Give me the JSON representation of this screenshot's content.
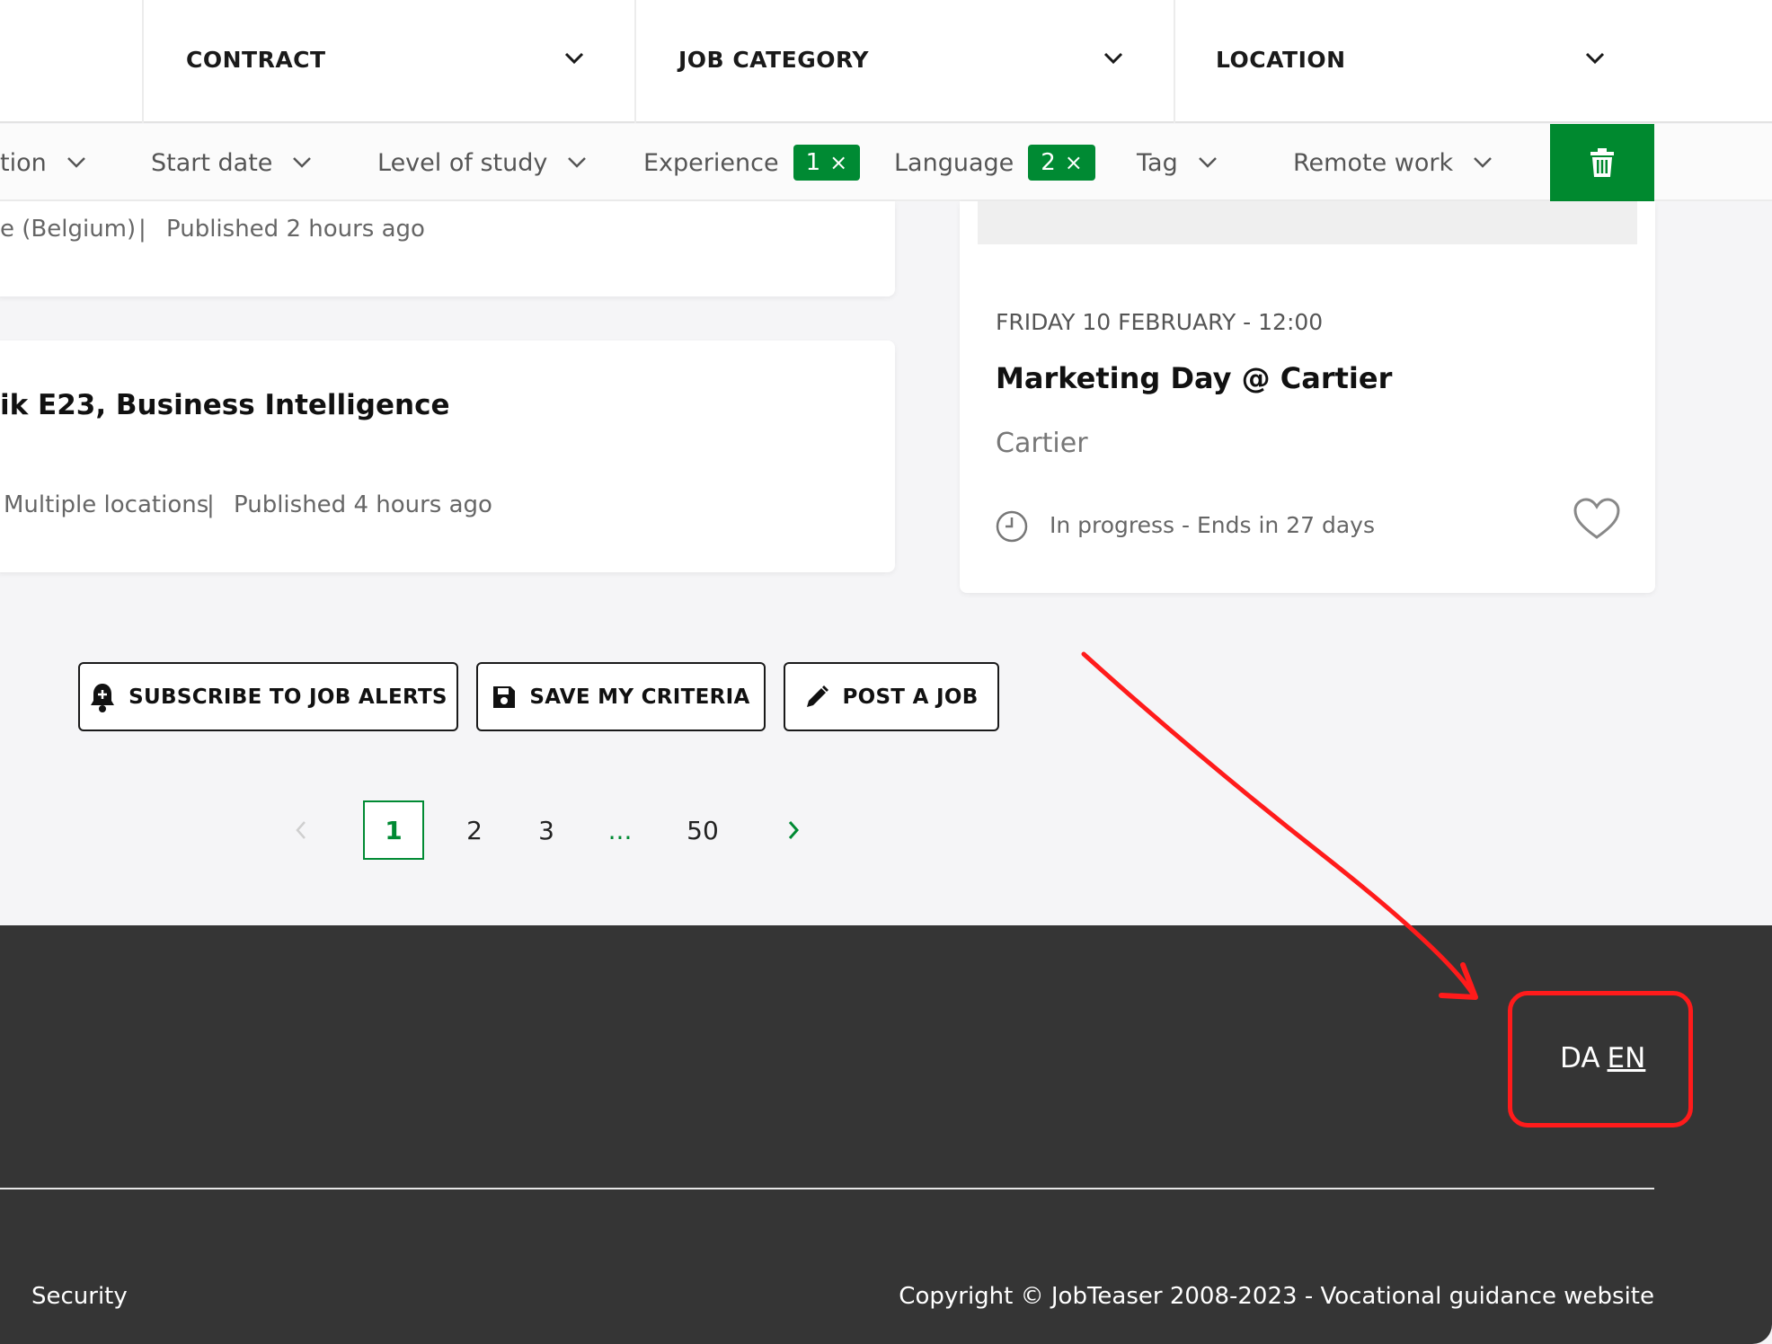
{
  "top_filters": [
    {
      "label": "CONTRACT"
    },
    {
      "label": "JOB CATEGORY"
    },
    {
      "label": "LOCATION"
    }
  ],
  "filters": [
    {
      "label": "tion",
      "badge": null
    },
    {
      "label": "Start date",
      "badge": null
    },
    {
      "label": "Level of study",
      "badge": null
    },
    {
      "label": "Experience",
      "badge": "1"
    },
    {
      "label": "Language",
      "badge": "2"
    },
    {
      "label": "Tag",
      "badge": null
    },
    {
      "label": "Remote work",
      "badge": null
    }
  ],
  "badge_close": "×",
  "job_card_1": {
    "location": "e (Belgium)",
    "sep": "|",
    "published": "Published 2 hours ago"
  },
  "job_card_2": {
    "title": "ik E23, Business Intelligence",
    "location": "Multiple locations",
    "sep": "|",
    "published": "Published 4 hours ago"
  },
  "event_card": {
    "date": "FRIDAY 10 FEBRUARY - 12:00",
    "title": "Marketing Day @ Cartier",
    "company": "Cartier",
    "status": "In progress - Ends in 27 days"
  },
  "actions": {
    "subscribe": "SUBSCRIBE TO JOB ALERTS",
    "save": "SAVE MY CRITERIA",
    "post": "POST A JOB"
  },
  "pagination": {
    "pages": [
      "1",
      "2",
      "3",
      "...",
      "50"
    ],
    "current": "1"
  },
  "footer": {
    "lang_da": "DA",
    "lang_en": "EN",
    "security": "Security",
    "copyright": "Copyright © JobTeaser 2008-2023 - Vocational guidance website"
  },
  "colors": {
    "accent_green": "#008a33",
    "footer_bg": "#353535",
    "annotation_red": "#ff1b1b"
  }
}
